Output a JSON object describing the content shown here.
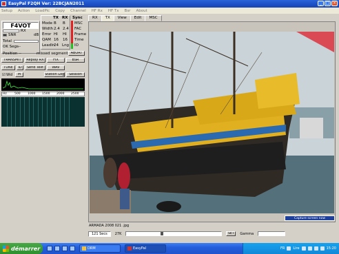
{
  "window": {
    "title": "EasyPal  F2QH   Ver:  22BCJAN2011"
  },
  "menu": [
    "Setup",
    "Action",
    "LoadPic",
    "Copy",
    "Channel",
    "HF Rx",
    "HF Tx",
    "Bsr",
    "About"
  ],
  "left_panel": {
    "callsign": "F4VOT",
    "rx_label": "RX",
    "snr_label": "SNR",
    "db_label": "dB",
    "total_label": "Total",
    "ok_segs_label": "OK Segs",
    "ok_segs_value": "--",
    "position_label": "Position",
    "position_value": "--",
    "missed_label": "missed segments",
    "abort_label": "ABORT",
    "tx_header": "TX",
    "rx_header": "RX",
    "sync_header": "Sync",
    "mode_label": "Mode",
    "mode_tx": "B",
    "mode_rx": "B",
    "width_label": "Width",
    "width_tx": "2.4",
    "width_rx": "2.4",
    "error_label": "Error",
    "error_tx": "HI",
    "error_rx": "HI",
    "qam_label": "QAM",
    "qam_tx": "16",
    "qam_rx": "16",
    "leadin_label": "LeadIn",
    "leadin_tx": "24",
    "leadin_rx": "Lng",
    "sync_items": [
      "MSC",
      "FAC",
      "Frame",
      "Time",
      "IO"
    ],
    "sync_colors": [
      "#e02020",
      "#e02020",
      "#e02020",
      "#e02020",
      "#20c020"
    ],
    "buttons_row1": [
      "TRANSMIT",
      "Replay RX",
      "FIX",
      "BSR"
    ],
    "buttons_row2": [
      "TUNE",
      "ID",
      "Send Text",
      "WAV"
    ],
    "buttons_row3": [
      "Station Log",
      "Session"
    ],
    "check1": "Wd",
    "check2": "M",
    "freq_scale": [
      "Hz",
      "500",
      "1000",
      "1500",
      "2000",
      "2500"
    ]
  },
  "tabs": [
    "RX",
    "TX",
    "View",
    "Edit",
    "MSC"
  ],
  "active_tab": 1,
  "image_caption": "ARMADA 2008 021 .jpg",
  "capture_tip": "Capture screen now",
  "status": {
    "secs": "121 Secs",
    "size": "27K",
    "set_label": "SET",
    "gamma_label": "Gamma"
  },
  "taskbar": {
    "start": "démarrer",
    "tasks": [
      "DRM",
      "EasyPal"
    ],
    "lang": "FR",
    "clock": "15:20",
    "volume_label": "Lire"
  },
  "colors": {
    "title_blue": "#1c4fc4",
    "panel": "#d4d0c8",
    "sync_red": "#e02020",
    "sync_green": "#20c020"
  }
}
